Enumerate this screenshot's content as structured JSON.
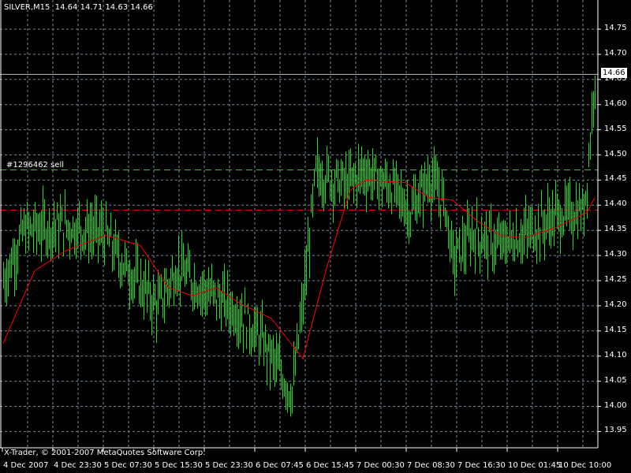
{
  "header": {
    "symbol": "SILVER,M15",
    "open": "14.64",
    "high": "14.71",
    "low": "14.63",
    "close": "14.66"
  },
  "copyright": "X-Trader, © 2001-2007 MetaQuotes Software Corp.",
  "order": {
    "label": "#1296462 sell",
    "open_price": 14.47,
    "stop_loss": 14.39
  },
  "bid": {
    "price": 14.66,
    "label": "14.66"
  },
  "colors": {
    "background": "#000000",
    "grid": "#778899",
    "bars": "#32cd32",
    "ma": "#ff0000",
    "order_line": "#32cd32",
    "sl_line": "#ff0000",
    "bid_line": "#c0c0c0",
    "axis": "#ffffff"
  },
  "chart_data": {
    "type": "ohlc-bar",
    "timeframe": "M15",
    "ylim": [
      13.93,
      14.77
    ],
    "price_ticks": [
      "14.75",
      "14.70",
      "14.65",
      "14.60",
      "14.55",
      "14.50",
      "14.45",
      "14.40",
      "14.35",
      "14.30",
      "14.25",
      "14.20",
      "14.15",
      "14.10",
      "14.05",
      "14.00",
      "13.95"
    ],
    "time_ticks": [
      "4 Dec 2007",
      "4 Dec 23:30",
      "5 Dec 07:30",
      "5 Dec 15:30",
      "5 Dec 23:30",
      "6 Dec 07:45",
      "6 Dec 15:45",
      "7 Dec 00:30",
      "7 Dec 08:30",
      "7 Dec 16:30",
      "10 Dec 01:45",
      "10 Dec 10:00"
    ],
    "bar_count": 376,
    "price_path": [
      [
        0,
        14.25
      ],
      [
        13,
        14.35
      ],
      [
        38,
        14.36
      ],
      [
        63,
        14.345
      ],
      [
        78,
        14.275
      ],
      [
        98,
        14.2
      ],
      [
        110,
        14.275
      ],
      [
        128,
        14.23
      ],
      [
        148,
        14.19
      ],
      [
        163,
        14.135
      ],
      [
        183,
        14.025
      ],
      [
        190,
        14.21
      ],
      [
        198,
        14.465
      ],
      [
        218,
        14.44
      ],
      [
        228,
        14.47
      ],
      [
        248,
        14.43
      ],
      [
        258,
        14.385
      ],
      [
        270,
        14.455
      ],
      [
        280,
        14.4
      ],
      [
        285,
        14.29
      ],
      [
        298,
        14.345
      ],
      [
        313,
        14.32
      ],
      [
        333,
        14.345
      ],
      [
        348,
        14.375
      ],
      [
        368,
        14.39
      ],
      [
        372,
        14.53
      ],
      [
        375,
        14.67
      ]
    ],
    "ma_path": [
      [
        0,
        14.125
      ],
      [
        20,
        14.27
      ],
      [
        40,
        14.31
      ],
      [
        65,
        14.34
      ],
      [
        87,
        14.32
      ],
      [
        105,
        14.236
      ],
      [
        120,
        14.22
      ],
      [
        135,
        14.236
      ],
      [
        150,
        14.205
      ],
      [
        170,
        14.175
      ],
      [
        190,
        14.095
      ],
      [
        205,
        14.275
      ],
      [
        220,
        14.43
      ],
      [
        230,
        14.45
      ],
      [
        255,
        14.445
      ],
      [
        270,
        14.415
      ],
      [
        285,
        14.41
      ],
      [
        300,
        14.37
      ],
      [
        315,
        14.34
      ],
      [
        330,
        14.335
      ],
      [
        350,
        14.355
      ],
      [
        370,
        14.385
      ],
      [
        375,
        14.415
      ]
    ]
  }
}
